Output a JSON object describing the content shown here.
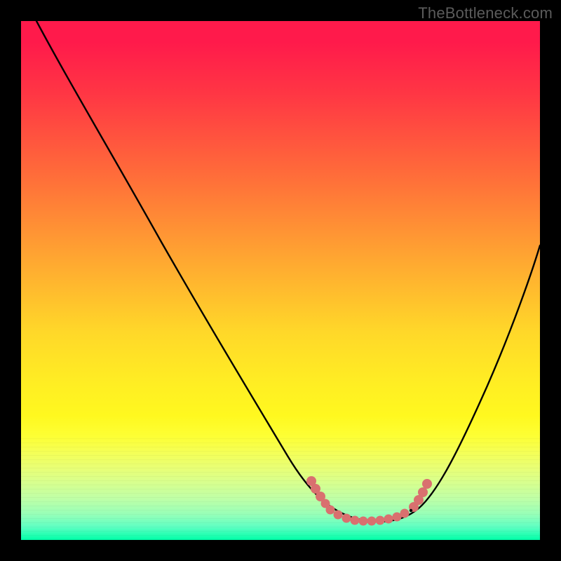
{
  "watermark": "TheBottleneck.com",
  "chart_data": {
    "type": "line",
    "title": "",
    "xlabel": "",
    "ylabel": "",
    "xlim": [
      0,
      100
    ],
    "ylim": [
      0,
      100
    ],
    "grid": false,
    "legend": false,
    "series": [
      {
        "name": "bottleneck-curve",
        "x": [
          3,
          10,
          20,
          30,
          40,
          50,
          55,
          58,
          60,
          65,
          70,
          75,
          78,
          82,
          88,
          95,
          100
        ],
        "y": [
          100,
          87,
          72,
          58,
          43,
          28,
          18,
          11,
          7,
          4,
          3,
          4,
          7,
          14,
          30,
          52,
          70
        ],
        "color": "#000000"
      },
      {
        "name": "sweet-spot-marker",
        "x": [
          56,
          58,
          60,
          62,
          64,
          66,
          68,
          70,
          72,
          74,
          76,
          77,
          78
        ],
        "y": [
          11,
          8.5,
          6.5,
          5.3,
          4.5,
          4,
          3.8,
          3.8,
          4,
          4.5,
          6.5,
          9,
          11.5
        ],
        "color": "#d9706f"
      }
    ],
    "background_gradient": {
      "top": "#ff1a4b",
      "mid_upper": "#ffa731",
      "mid_lower": "#ffee23",
      "bottom": "#00ffa8"
    }
  }
}
